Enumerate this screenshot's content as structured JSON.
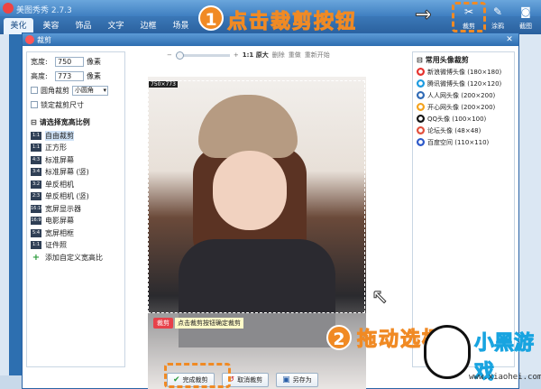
{
  "app": {
    "title": "美图秀秀 2.7.3",
    "tabs": [
      "美化",
      "美容",
      "饰品",
      "文字",
      "边框",
      "场景"
    ],
    "tools": [
      {
        "label": "裁剪",
        "icon": "scissors-icon"
      },
      {
        "label": "涂鸦",
        "icon": "brush-icon"
      },
      {
        "label": "截图",
        "icon": "camera-icon"
      }
    ]
  },
  "dialog": {
    "title": "裁剪",
    "close": "✕",
    "width_label": "宽度:",
    "width_value": "750",
    "width_unit": "像素",
    "height_label": "高度:",
    "height_value": "773",
    "height_unit": "像素",
    "rounded_label": "圆角裁剪",
    "rounded_select": "小圆角",
    "lock_label": "锁定裁剪尺寸",
    "ratio_header": "请选择宽高比例",
    "ratios": [
      {
        "icon": "1:1",
        "label": "自由裁剪",
        "selected": true
      },
      {
        "icon": "1:1",
        "label": "正方形"
      },
      {
        "icon": "4:3",
        "label": "标准屏幕"
      },
      {
        "icon": "3:4",
        "label": "标准屏幕 (竖)"
      },
      {
        "icon": "3:2",
        "label": "单反相机"
      },
      {
        "icon": "2:3",
        "label": "单反相机 (竖)"
      },
      {
        "icon": "16:10",
        "label": "宽屏显示器"
      },
      {
        "icon": "16:9",
        "label": "电影屏幕"
      },
      {
        "icon": "5:4",
        "label": "宽屏相框"
      },
      {
        "icon": "1:1",
        "label": "证件照"
      }
    ],
    "add_custom": "添加自定义宽高比",
    "zoom": {
      "minus": "−",
      "plus": "+",
      "original": "1:1 原大",
      "delete": "删除",
      "redo": "重做",
      "reset": "重新开始"
    },
    "crop_size": "750×773",
    "hint_tag": "裁剪",
    "hint_text": "点击裁剪按钮确定裁剪",
    "avatar_header": "常用头像裁剪",
    "avatars": [
      {
        "label": "新浪微博头像 (180×180)",
        "color": "#e6322e"
      },
      {
        "label": "腾讯微博头像 (120×120)",
        "color": "#1a9ae0"
      },
      {
        "label": "人人网头像 (200×200)",
        "color": "#2f6ab5"
      },
      {
        "label": "开心网头像 (200×200)",
        "color": "#f4a21b"
      },
      {
        "label": "QQ头像 (100×100)",
        "color": "#111111"
      },
      {
        "label": "论坛头像 (48×48)",
        "color": "#e24f3b"
      },
      {
        "label": "百度空间 (110×110)",
        "color": "#2c58c9"
      }
    ],
    "buttons": {
      "confirm": "完成裁剪",
      "cancel": "取消裁剪",
      "save_as": "另存为"
    }
  },
  "overlay": {
    "step1_number": "1",
    "step1_text": "点击裁剪按钮",
    "step1_arrow": "→",
    "step2_number": "2",
    "step2_text": "拖动选框",
    "step2_arrow": "↖",
    "accent": "#f08a24"
  },
  "watermark": {
    "title": "小黑游戏",
    "site": "www.xiaohei.com"
  }
}
